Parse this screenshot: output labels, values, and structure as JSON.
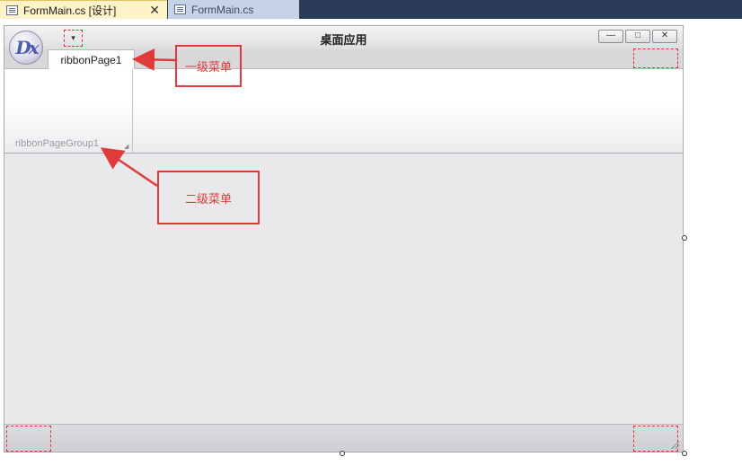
{
  "ide_tabs": [
    {
      "label": "FormMain.cs [设计]",
      "active": true,
      "close": "✕"
    },
    {
      "label": "FormMain.cs",
      "active": false
    }
  ],
  "form": {
    "title": "桌面应用",
    "app_logo_text": "Dx",
    "qat_dropdown_glyph": "▾",
    "window_buttons": {
      "minimize": "—",
      "maximize": "□",
      "close": "✕"
    },
    "ribbon_tab": "ribbonPage1",
    "page_group_caption": "ribbonPageGroup1",
    "group_launcher_glyph": "◢"
  },
  "annotations": {
    "first_level": "一级菜单",
    "second_level": "二级菜单"
  },
  "colors": {
    "annotation_red": "#e03a3a",
    "ide_active_tab": "#fdf2c8",
    "ide_bar": "#2b3c59"
  },
  "icons": [
    "document-icon",
    "close-icon",
    "dropdown-arrow-icon",
    "minimize-icon",
    "maximize-icon",
    "window-close-icon",
    "size-grip-icon"
  ]
}
